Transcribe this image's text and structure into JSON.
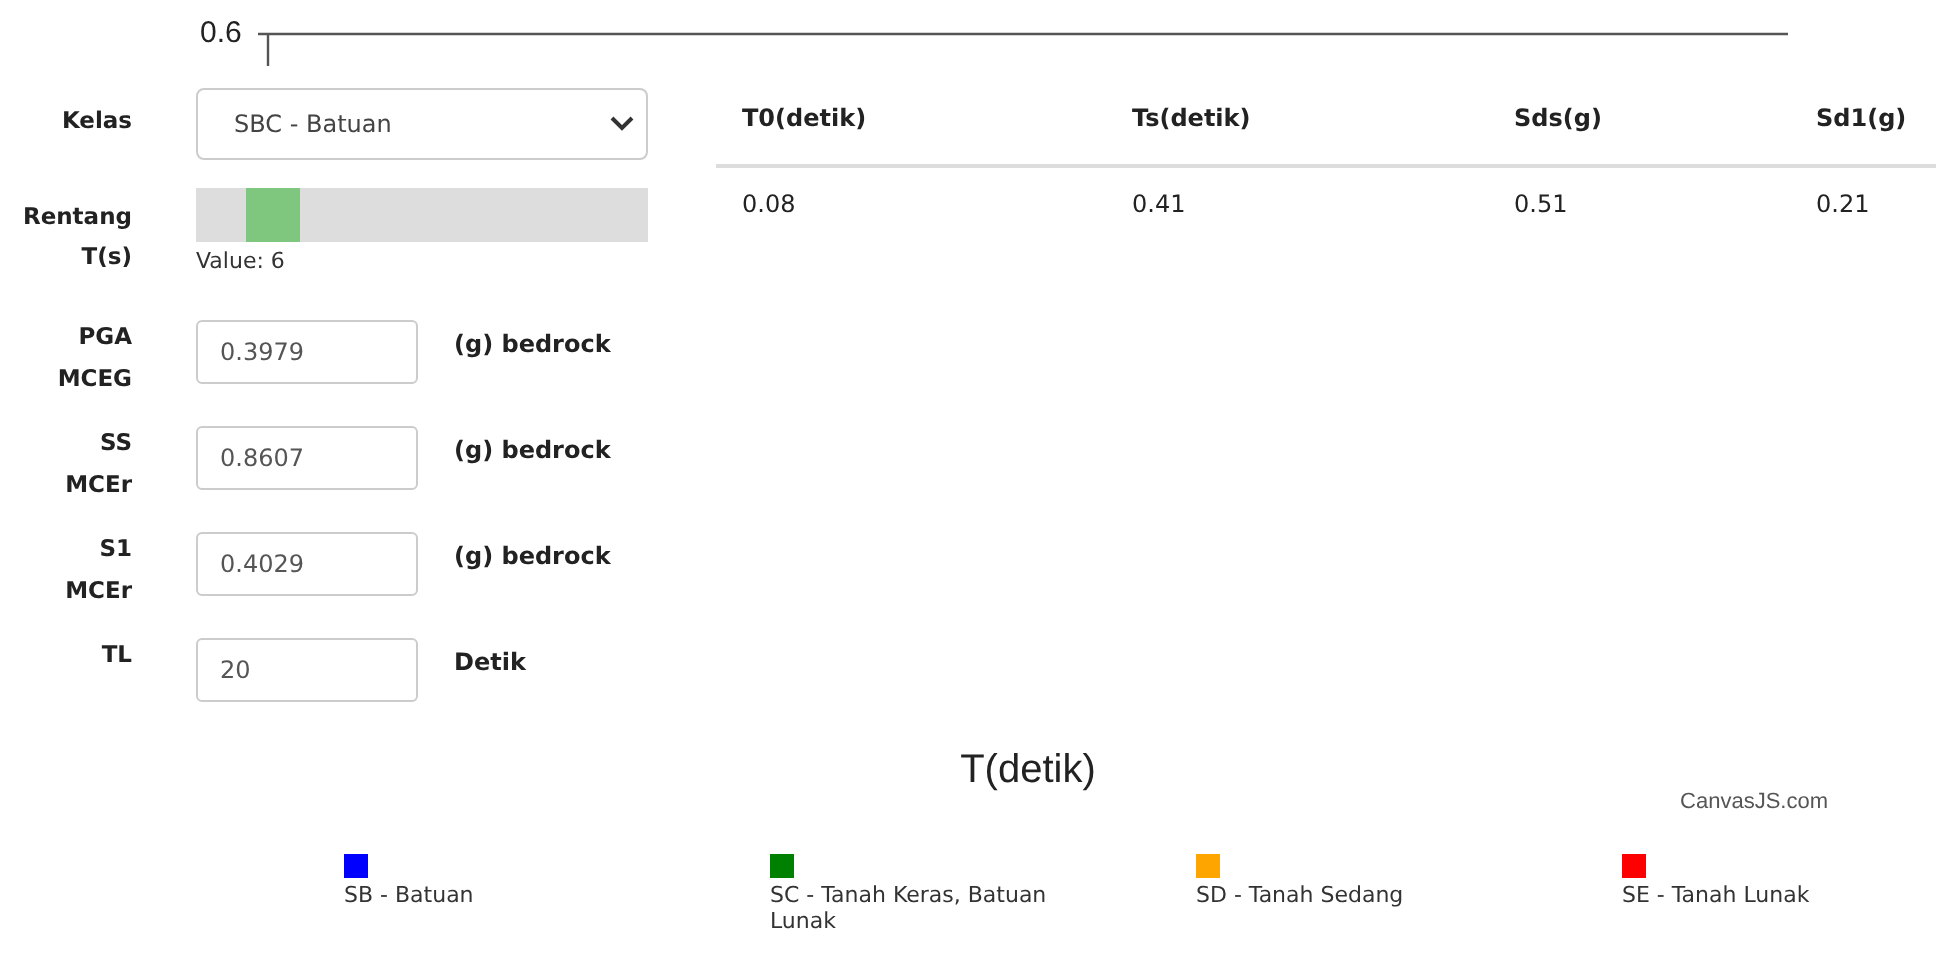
{
  "chart_top": {
    "y_tick_label": "0.6"
  },
  "form": {
    "class_field": {
      "label": "Kelas",
      "value": "SBC - Batuan"
    },
    "range": {
      "label": "Rentang T(s)",
      "level": 0.125,
      "reading": "Value: 6"
    },
    "inputs": [
      {
        "label": "PGA MCEG",
        "value": "0.3979",
        "unit": "(g) bedrock"
      },
      {
        "label": "SS MCEr",
        "value": "0.8607",
        "unit": "(g) bedrock"
      },
      {
        "label": "S1 MCEr",
        "value": "0.4029",
        "unit": "(g) bedrock"
      },
      {
        "label": "TL",
        "value": "20",
        "unit": "Detik"
      }
    ]
  },
  "table": {
    "columns": [
      "T0(detik)",
      "Ts(detik)",
      "Sds(g)",
      "Sd1(g)"
    ],
    "rows": [
      [
        "0.08",
        "0.41",
        "0.51",
        "0.21"
      ]
    ]
  },
  "chart_bottom": {
    "axis_title": "T(detik)",
    "credit": "CanvasJS.com",
    "legend": [
      {
        "label": "SB - Batuan",
        "color": "#0000ff"
      },
      {
        "label": "SC - Tanah Keras, Batuan Lunak",
        "color": "#008000"
      },
      {
        "label": "SD - Tanah Sedang",
        "color": "#ffa500"
      },
      {
        "label": "SE - Tanah Lunak",
        "color": "#ff0000"
      }
    ]
  }
}
